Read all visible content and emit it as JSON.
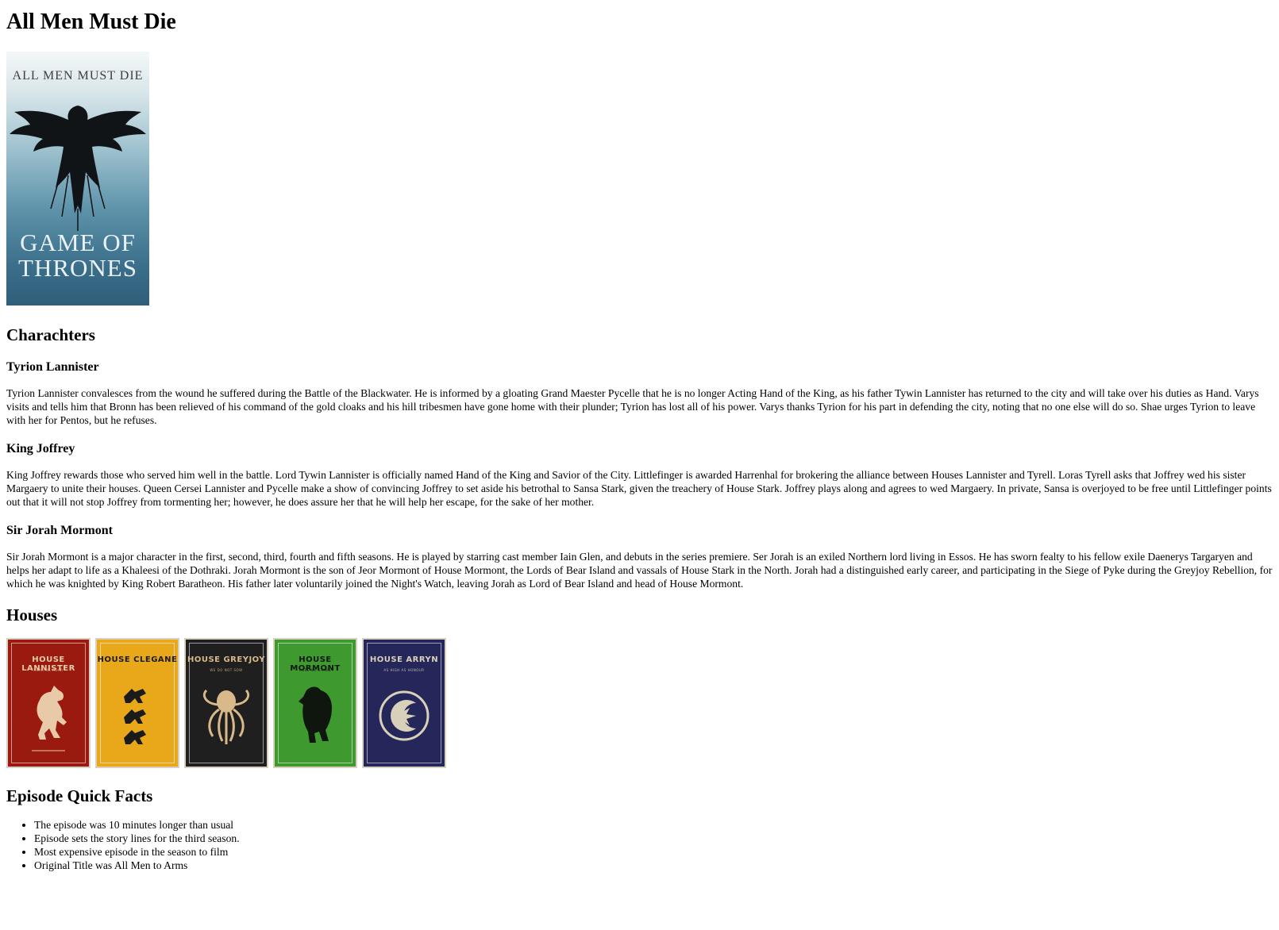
{
  "page": {
    "title": "All Men Must Die"
  },
  "poster": {
    "tagline": "ALL MEN MUST DIE",
    "logo_line1": "GAME OF",
    "logo_line2": "THRONES"
  },
  "characters": {
    "heading": "Charachters",
    "items": [
      {
        "name": "Tyrion Lannister",
        "text": "Tyrion Lannister convalesces from the wound he suffered during the Battle of the Blackwater. He is informed by a gloating Grand Maester Pycelle that he is no longer Acting Hand of the King, as his father Tywin Lannister has returned to the city and will take over his duties as Hand. Varys visits and tells him that Bronn has been relieved of his command of the gold cloaks and his hill tribesmen have gone home with their plunder; Tyrion has lost all of his power. Varys thanks Tyrion for his part in defending the city, noting that no one else will do so. Shae urges Tyrion to leave with her for Pentos, but he refuses."
      },
      {
        "name": "King Joffrey",
        "text": "King Joffrey rewards those who served him well in the battle. Lord Tywin Lannister is officially named Hand of the King and Savior of the City. Littlefinger is awarded Harrenhal for brokering the alliance between Houses Lannister and Tyrell. Loras Tyrell asks that Joffrey wed his sister Margaery to unite their houses. Queen Cersei Lannister and Pycelle make a show of convincing Joffrey to set aside his betrothal to Sansa Stark, given the treachery of House Stark. Joffrey plays along and agrees to wed Margaery. In private, Sansa is overjoyed to be free until Littlefinger points out that it will not stop Joffrey from tormenting her; however, he does assure her that he will help her escape, for the sake of her mother."
      },
      {
        "name": "Sir Jorah Mormont",
        "text": "Sir Jorah Mormont is a major character in the first, second, third, fourth and fifth seasons. He is played by starring cast member Iain Glen, and debuts in the series premiere. Ser Jorah is an exiled Northern lord living in Essos. He has sworn fealty to his fellow exile Daenerys Targaryen and helps her adapt to life as a Khaleesi of the Dothraki. Jorah Mormont is the son of Jeor Mormont of House Mormont, the Lords of Bear Island and vassals of House Stark in the North. Jorah had a distinguished early career, and participating in the Siege of Pyke during the Greyjoy Rebellion, for which he was knighted by King Robert Baratheon. His father later voluntarily joined the Night's Watch, leaving Jorah as Lord of Bear Island and head of House Mormont."
      }
    ]
  },
  "houses": {
    "heading": "Houses",
    "items": [
      {
        "name": "HOUSE LANNISTER",
        "motto": "HEAR ME ROAR",
        "bg": "#9b1a10",
        "fg": "#e8c9a8",
        "sigil": "lion"
      },
      {
        "name": "HOUSE CLEGANE",
        "motto": "",
        "bg": "#e8a81a",
        "fg": "#1b1b1b",
        "sigil": "dogs"
      },
      {
        "name": "HOUSE GREYJOY",
        "motto": "WE DO NOT SOW",
        "bg": "#1f1f1f",
        "fg": "#d9b88a",
        "sigil": "kraken"
      },
      {
        "name": "HOUSE MORMONT",
        "motto": "HERE WE STAND",
        "bg": "#3e9a2e",
        "fg": "#0f160e",
        "sigil": "bear"
      },
      {
        "name": "HOUSE ARRYN",
        "motto": "AS HIGH AS HONOUR",
        "bg": "#25275a",
        "fg": "#d8d0b8",
        "sigil": "falcon"
      }
    ]
  },
  "facts": {
    "heading": "Episode Quick Facts",
    "items": [
      "The episode was 10 minutes longer than usual",
      "Episode sets the story lines for the third season.",
      "Most expensive episode in the season to film",
      "Original Title was All Men to Arms"
    ]
  }
}
